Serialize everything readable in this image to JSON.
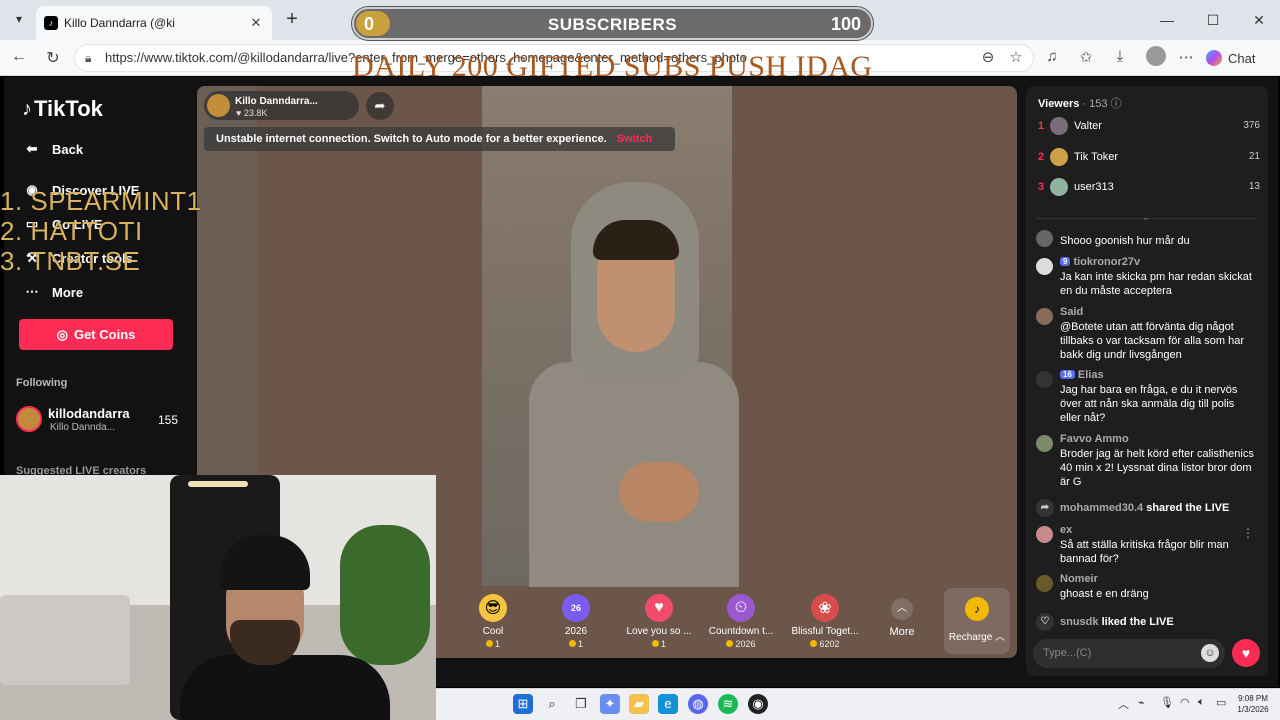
{
  "browser": {
    "tab_title": "Killo Danndarra",
    "tab_title_suffix": "(@ki",
    "url": "https://www.tiktok.com/@killodandarra/live?enter_from_merge=others_homepage&enter_method=others_photo",
    "chat_label": "Chat"
  },
  "overlay": {
    "subs_current": "0",
    "subs_label": "SUBSCRIBERS",
    "subs_goal": "100",
    "subs_progress": 0.0,
    "push_text": "DAILY 200 GIFTED SUBS PUSH IDAG",
    "top_gifters": [
      "1. SPEARMINT1",
      "2. HATTOTI",
      "3. TNBT.SE"
    ]
  },
  "sidebar": {
    "logo": "TikTok",
    "nav": [
      {
        "label": "Back",
        "icon": "back-arrow-icon"
      },
      {
        "label": "Discover LIVE",
        "icon": "discover-icon"
      },
      {
        "label": "Go LIVE",
        "icon": "camera-icon"
      },
      {
        "label": "Creator tools",
        "icon": "tools-icon"
      },
      {
        "label": "More",
        "icon": "more-icon"
      }
    ],
    "get_coins": "Get Coins",
    "following_heading": "Following",
    "following": {
      "name": "killodandarra",
      "sub": "Killo Dannda...",
      "count": "155"
    },
    "suggested_heading": "Suggested LIVE creators"
  },
  "live": {
    "host_name": "Killo Danndarra...",
    "likes": "23.8K",
    "warning": "Unstable internet connection. Switch to Auto mode for a better experience.",
    "warning_action": "Switch"
  },
  "gifts": [
    {
      "name": "Cool",
      "price": "1",
      "icon": "sunglasses-icon",
      "color": "#f5c542"
    },
    {
      "name": "2026",
      "price": "1",
      "icon": "2026-icon",
      "color": "#7b5cf2"
    },
    {
      "name": "Love you so ...",
      "price": "1",
      "icon": "heart-icon",
      "color": "#f24b6a"
    },
    {
      "name": "Countdown t...",
      "price": "2026",
      "icon": "countdown-icon",
      "color": "#9b59d0"
    },
    {
      "name": "Blissful Toget...",
      "price": "6202",
      "icon": "blissful-icon",
      "color": "#d94c4c"
    }
  ],
  "gift_more": "More",
  "recharge": "Recharge",
  "viewers": {
    "heading": "Viewers",
    "count": "· 153",
    "top": [
      {
        "rank": "1",
        "name": "Valter",
        "score": "376",
        "color": "#7a6c7a"
      },
      {
        "rank": "2",
        "name": "Tik Toker",
        "score": "21",
        "color": "#c9a24a"
      },
      {
        "rank": "3",
        "name": "user313",
        "score": "13",
        "color": "#8fb5a0"
      }
    ]
  },
  "chat": [
    {
      "user": "",
      "text": "Shooo goonish hur mår du",
      "color": "#666"
    },
    {
      "user": "tiokronor27v",
      "badge": "9",
      "text": "Ja kan inte skicka pm har redan skickat en du måste acceptera",
      "color": "#ddd"
    },
    {
      "user": "Said",
      "text": "@Botete utan att förvänta dig något tillbaks o var tacksam för alla som har bakk dig undr livsgången",
      "color": "#8a6a5a"
    },
    {
      "user": "Elias",
      "badge": "16",
      "text": "Jag har bara en fråga, e du it nervös över att nån ska anmäla dig till polis eller nåt?",
      "color": "#333"
    },
    {
      "user": "Favvo Ammo",
      "text": "Broder jag är helt körd efter calisthenics 40 min x 2! Lyssnat dina listor bror dom är G",
      "color": "#7a8a6a"
    },
    {
      "user": "ex",
      "text": "Så att ställa kritiska frågor blir man bannad för?",
      "color": "#c98a8a"
    },
    {
      "user": "Nomeir",
      "text": "ghoast e en dräng",
      "color": "#6a5a2a"
    }
  ],
  "system": [
    {
      "user": "mohammed30.4",
      "action": "shared the LIVE"
    },
    {
      "user": "snusdk",
      "action": "liked the LIVE"
    }
  ],
  "chat_input_placeholder": "Type...(C)",
  "clock": {
    "time": "9:08 PM",
    "date": "1/3/2026"
  }
}
